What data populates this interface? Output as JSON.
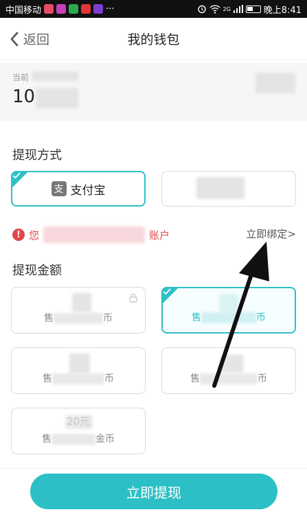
{
  "status_bar": {
    "carrier": "中国移动",
    "more": "···",
    "network": "2G",
    "time": "晚上8:41"
  },
  "nav": {
    "back_label": "返回",
    "title": "我的钱包"
  },
  "balance": {
    "label_partial": "当前",
    "value_partial": "10"
  },
  "withdraw_method": {
    "title": "提现方式",
    "options": [
      {
        "label": "支付宝",
        "icon": "alipay-icon",
        "selected": true
      }
    ]
  },
  "warning": {
    "prefix": "您",
    "suffix": "账户",
    "bind_link": "立即绑定>"
  },
  "withdraw_amount": {
    "title": "提现金额",
    "cards": [
      {
        "prefix": "售",
        "suffix": "币",
        "locked": true,
        "selected": false
      },
      {
        "prefix": "售",
        "suffix": "币",
        "locked": false,
        "selected": true
      },
      {
        "prefix": "售",
        "suffix": "币",
        "locked": false,
        "selected": false
      },
      {
        "prefix": "售",
        "suffix": "币",
        "locked": false,
        "selected": false
      },
      {
        "prefix": "售",
        "suffix": "金币",
        "top_text": "20元",
        "locked": false,
        "selected": false
      }
    ]
  },
  "footer": {
    "submit_label": "立即提现"
  },
  "colors": {
    "accent": "#2cc0c6",
    "warning": "#e04848"
  }
}
